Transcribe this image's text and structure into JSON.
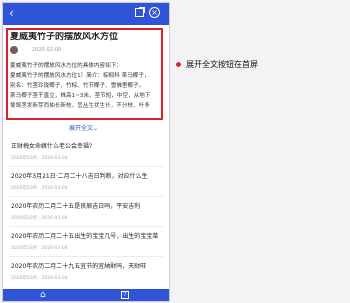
{
  "topbar": {
    "back_icon": "chevron-left",
    "title": "",
    "share_icon": "share",
    "close_icon": "close-circle",
    "close_glyph": "×"
  },
  "article": {
    "title": "夏威夷竹子的摆放风水方位",
    "author": "",
    "date": "2020-02-00",
    "lines": [
      "夏威夷竹子的摆放风水方位的具体内容如下：",
      "夏威夷竹子的摆放风水方位1）简介：棕榈科 茶马椰子，",
      "别名：竹茎玲珑椰子、竹棕、竹节椰子、雪佛里椰子。",
      "茶马椰子茎干直立，株高1~3米。茎节短，中空，从地下",
      "匍匐茎发新芽而抽长新枝，呈丛生状生长，不分枝，叶多"
    ]
  },
  "expand": {
    "label": "展开全文",
    "icon": "chevron-down"
  },
  "list": [
    {
      "title": "正财梅女命嫁什么老公会幸福?",
      "meta": "2020年03月 · 2020-03-04"
    },
    {
      "title": "2020年3月21日·二月二十八吉日判断，对应什么生",
      "meta": "2020年03月 · 2020-03-04"
    },
    {
      "title": "2020年农历二月二十五是良辰吉日吗，平安吉利",
      "meta": "2020年03月 · 2020-03-04"
    },
    {
      "title": "2020年农历二月二十五出生的宝宝几号，出生的宝宝菜",
      "meta": "2020年03月 · 2020-03-04"
    },
    {
      "title": "2020年农历二月二十九五宜节的宜納財吗，天财旺",
      "meta": "2020年03月 · 2020-03-04"
    }
  ],
  "bottombar": {
    "home_icon": "home",
    "help_icon": "help-square",
    "help_glyph": "?"
  },
  "annotation": {
    "label": "展开全文按钮在首屏"
  },
  "colors": {
    "accent": "#2f54d8",
    "highlight": "#e01f26"
  }
}
